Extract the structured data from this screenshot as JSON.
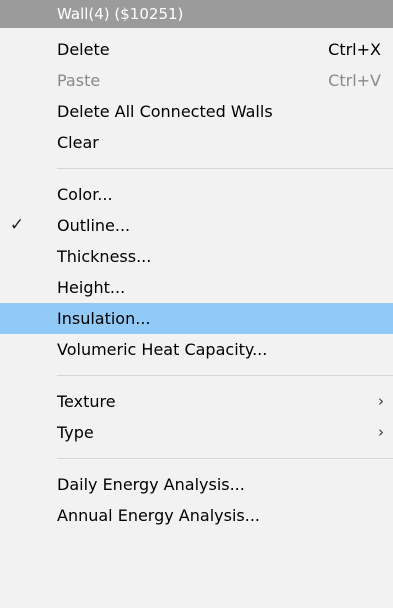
{
  "menu": {
    "header": "Wall(4) ($10251)",
    "items": [
      {
        "label": "Delete",
        "shortcut": "Ctrl+X"
      },
      {
        "label": "Paste",
        "shortcut": "Ctrl+V"
      },
      {
        "label": "Delete All Connected Walls"
      },
      {
        "label": "Clear"
      },
      {
        "label": "Color..."
      },
      {
        "label": "Outline..."
      },
      {
        "label": "Thickness..."
      },
      {
        "label": "Height..."
      },
      {
        "label": "Insulation..."
      },
      {
        "label": "Volumeric Heat Capacity..."
      },
      {
        "label": "Texture"
      },
      {
        "label": "Type"
      },
      {
        "label": "Daily Energy Analysis..."
      },
      {
        "label": "Annual Energy Analysis..."
      }
    ],
    "colors": {
      "background": "#f2f2f2",
      "header": "#9b9b9b",
      "highlight": "#91c9f7",
      "disabled_text": "#8a8a8a"
    }
  }
}
